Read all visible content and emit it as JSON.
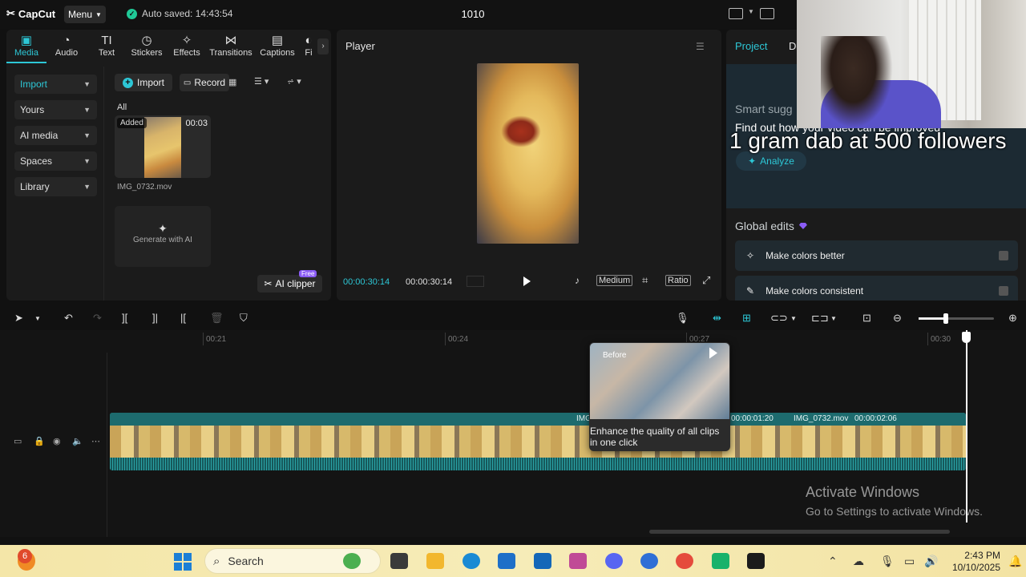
{
  "topbar": {
    "app_name": "CapCut",
    "menu_label": "Menu",
    "autosave_text": "Auto saved: 14:43:54",
    "project_title": "1010"
  },
  "media_tabs": [
    {
      "label": "Media",
      "icon": "play-square-icon",
      "active": true
    },
    {
      "label": "Audio",
      "icon": "audio-icon"
    },
    {
      "label": "Text",
      "icon": "text-icon"
    },
    {
      "label": "Stickers",
      "icon": "sticker-icon"
    },
    {
      "label": "Effects",
      "icon": "effects-icon"
    },
    {
      "label": "Transitions",
      "icon": "transitions-icon"
    },
    {
      "label": "Captions",
      "icon": "captions-icon"
    },
    {
      "label": "Fi",
      "icon": "filters-icon"
    }
  ],
  "sidenav": [
    {
      "label": "Import",
      "active": true
    },
    {
      "label": "Yours"
    },
    {
      "label": "AI media"
    },
    {
      "label": "Spaces"
    },
    {
      "label": "Library"
    }
  ],
  "media": {
    "import_button": "Import",
    "record_button": "Record",
    "all_label": "All",
    "clip": {
      "badge": "Added",
      "duration": "00:03",
      "name": "IMG_0732.mov"
    },
    "generate_ai": "Generate with AI",
    "ai_clipper": "AI clipper",
    "free_badge": "Free"
  },
  "player": {
    "title": "Player",
    "current_time": "00:00:30:14",
    "total_time": "00:00:30:14",
    "quality": "Medium",
    "ratio": "Ratio"
  },
  "right_panel": {
    "tabs": [
      "Project",
      "De"
    ],
    "smart_suggestions": "Smart sugg",
    "find_out": "Find out how your video can be improved",
    "analyze": "Analyze",
    "global_edits": "Global edits",
    "edits": [
      "Make colors better",
      "Make colors consistent"
    ]
  },
  "webcam_overlay_text": "1 gram dab at 500 followers",
  "timeline": {
    "ruler": [
      "00:21",
      "00:24",
      "00:27",
      "00:30"
    ],
    "clips": [
      {
        "name": "IMG",
        "time": "00:00:01:20"
      },
      {
        "name": "IMG_0732.mov",
        "time": "00:00:02:06"
      }
    ],
    "tooltip_before": "Before",
    "tooltip_text": "Enhance the quality of all clips in one click"
  },
  "watermark": {
    "title": "Activate Windows",
    "subtitle": "Go to Settings to activate Windows."
  },
  "taskbar": {
    "search_placeholder": "Search",
    "notification_count": "6",
    "time": "2:43 PM",
    "date": "10/10/2025"
  },
  "colors": {
    "accent": "#2dc7d6",
    "clip": "#1a5f62",
    "premium": "#8b5cf6"
  }
}
